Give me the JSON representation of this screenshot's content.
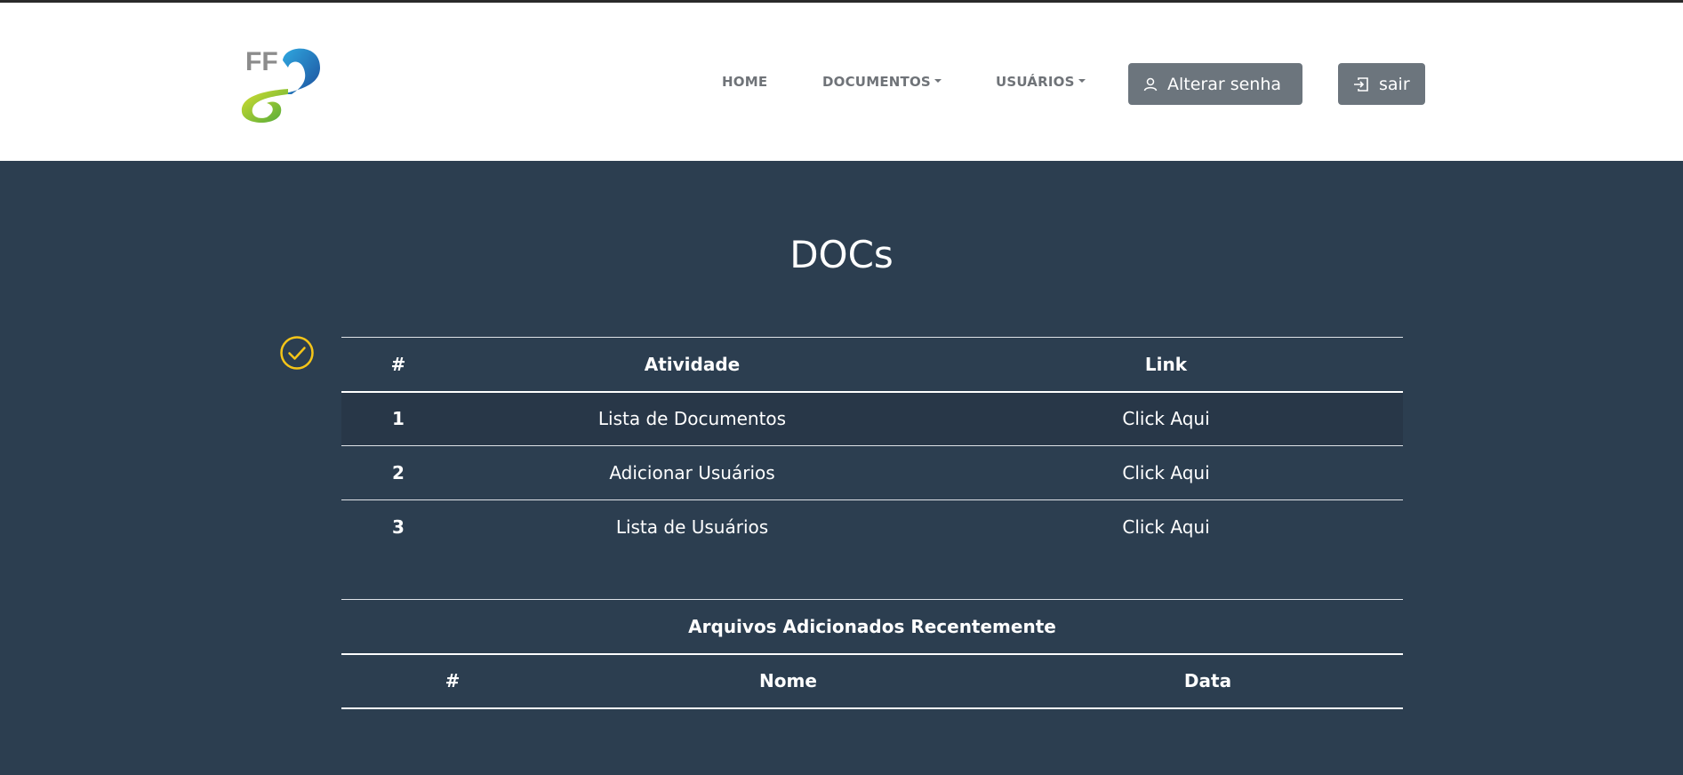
{
  "header": {
    "logo_text": "FF2",
    "nav": {
      "home": "HOME",
      "documentos": "DOCUMENTOS",
      "usuarios": "USUÁRIOS"
    },
    "buttons": {
      "change_password": "Alterar senha",
      "logout": "sair"
    }
  },
  "main": {
    "title": "DOCs",
    "activities_table": {
      "headers": [
        "#",
        "Atividade",
        "Link"
      ],
      "rows": [
        {
          "num": "1",
          "activity": "Lista de Documentos",
          "link": "Click Aqui"
        },
        {
          "num": "2",
          "activity": "Adicionar Usuários",
          "link": "Click Aqui"
        },
        {
          "num": "3",
          "activity": "Lista de Usuários",
          "link": "Click Aqui"
        }
      ]
    },
    "recent_files_table": {
      "caption": "Arquivos Adicionados Recentemente",
      "headers": [
        "#",
        "Nome",
        "Data"
      ]
    }
  },
  "colors": {
    "background": "#2c3e50",
    "navbar": "#ffffff",
    "button": "#6c757d",
    "check_icon": "#f5c518"
  },
  "icons": {
    "change_password": "user-icon",
    "logout": "login-box-icon",
    "status": "check-circle-icon"
  }
}
